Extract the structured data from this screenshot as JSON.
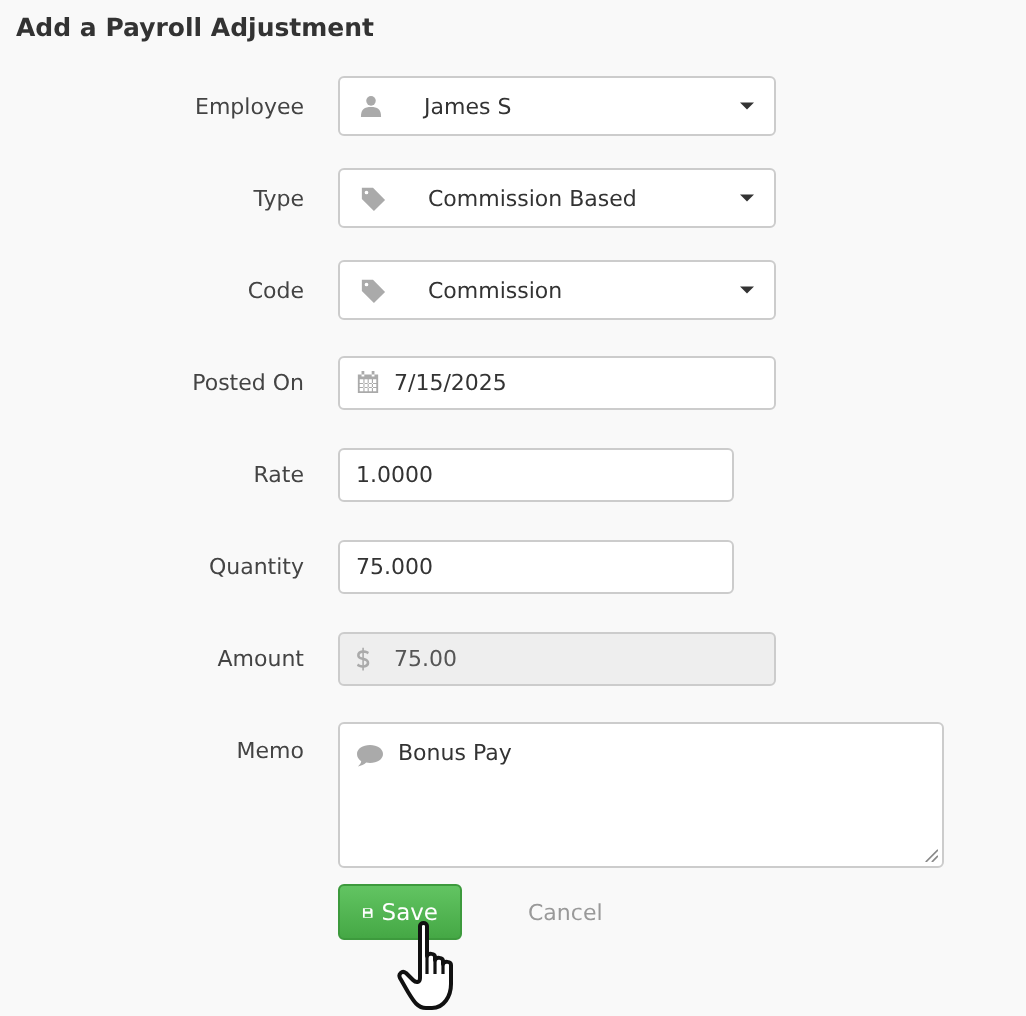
{
  "title": "Add a Payroll Adjustment",
  "fields": [
    {
      "label": "Employee",
      "kind": "select",
      "value": "James S",
      "disabled": false
    },
    {
      "label": "Type",
      "kind": "select",
      "value": "Commission Based",
      "disabled": false
    },
    {
      "label": "Code",
      "kind": "select",
      "value": "Commission",
      "disabled": false
    },
    {
      "label": "Posted On",
      "kind": "date",
      "value": "7/15/2025",
      "disabled": false
    },
    {
      "label": "Rate",
      "kind": "text",
      "value": "1.0000",
      "disabled": false
    },
    {
      "label": "Quantity",
      "kind": "text",
      "value": "75.000",
      "disabled": false
    },
    {
      "label": "Amount",
      "kind": "currency",
      "value": "75.00",
      "disabled": true
    },
    {
      "label": "Memo",
      "kind": "textarea",
      "value": "Bonus Pay",
      "disabled": false
    }
  ],
  "buttons": [
    {
      "label": "Save",
      "kind": "primary"
    },
    {
      "label": "Cancel",
      "kind": "link"
    }
  ]
}
